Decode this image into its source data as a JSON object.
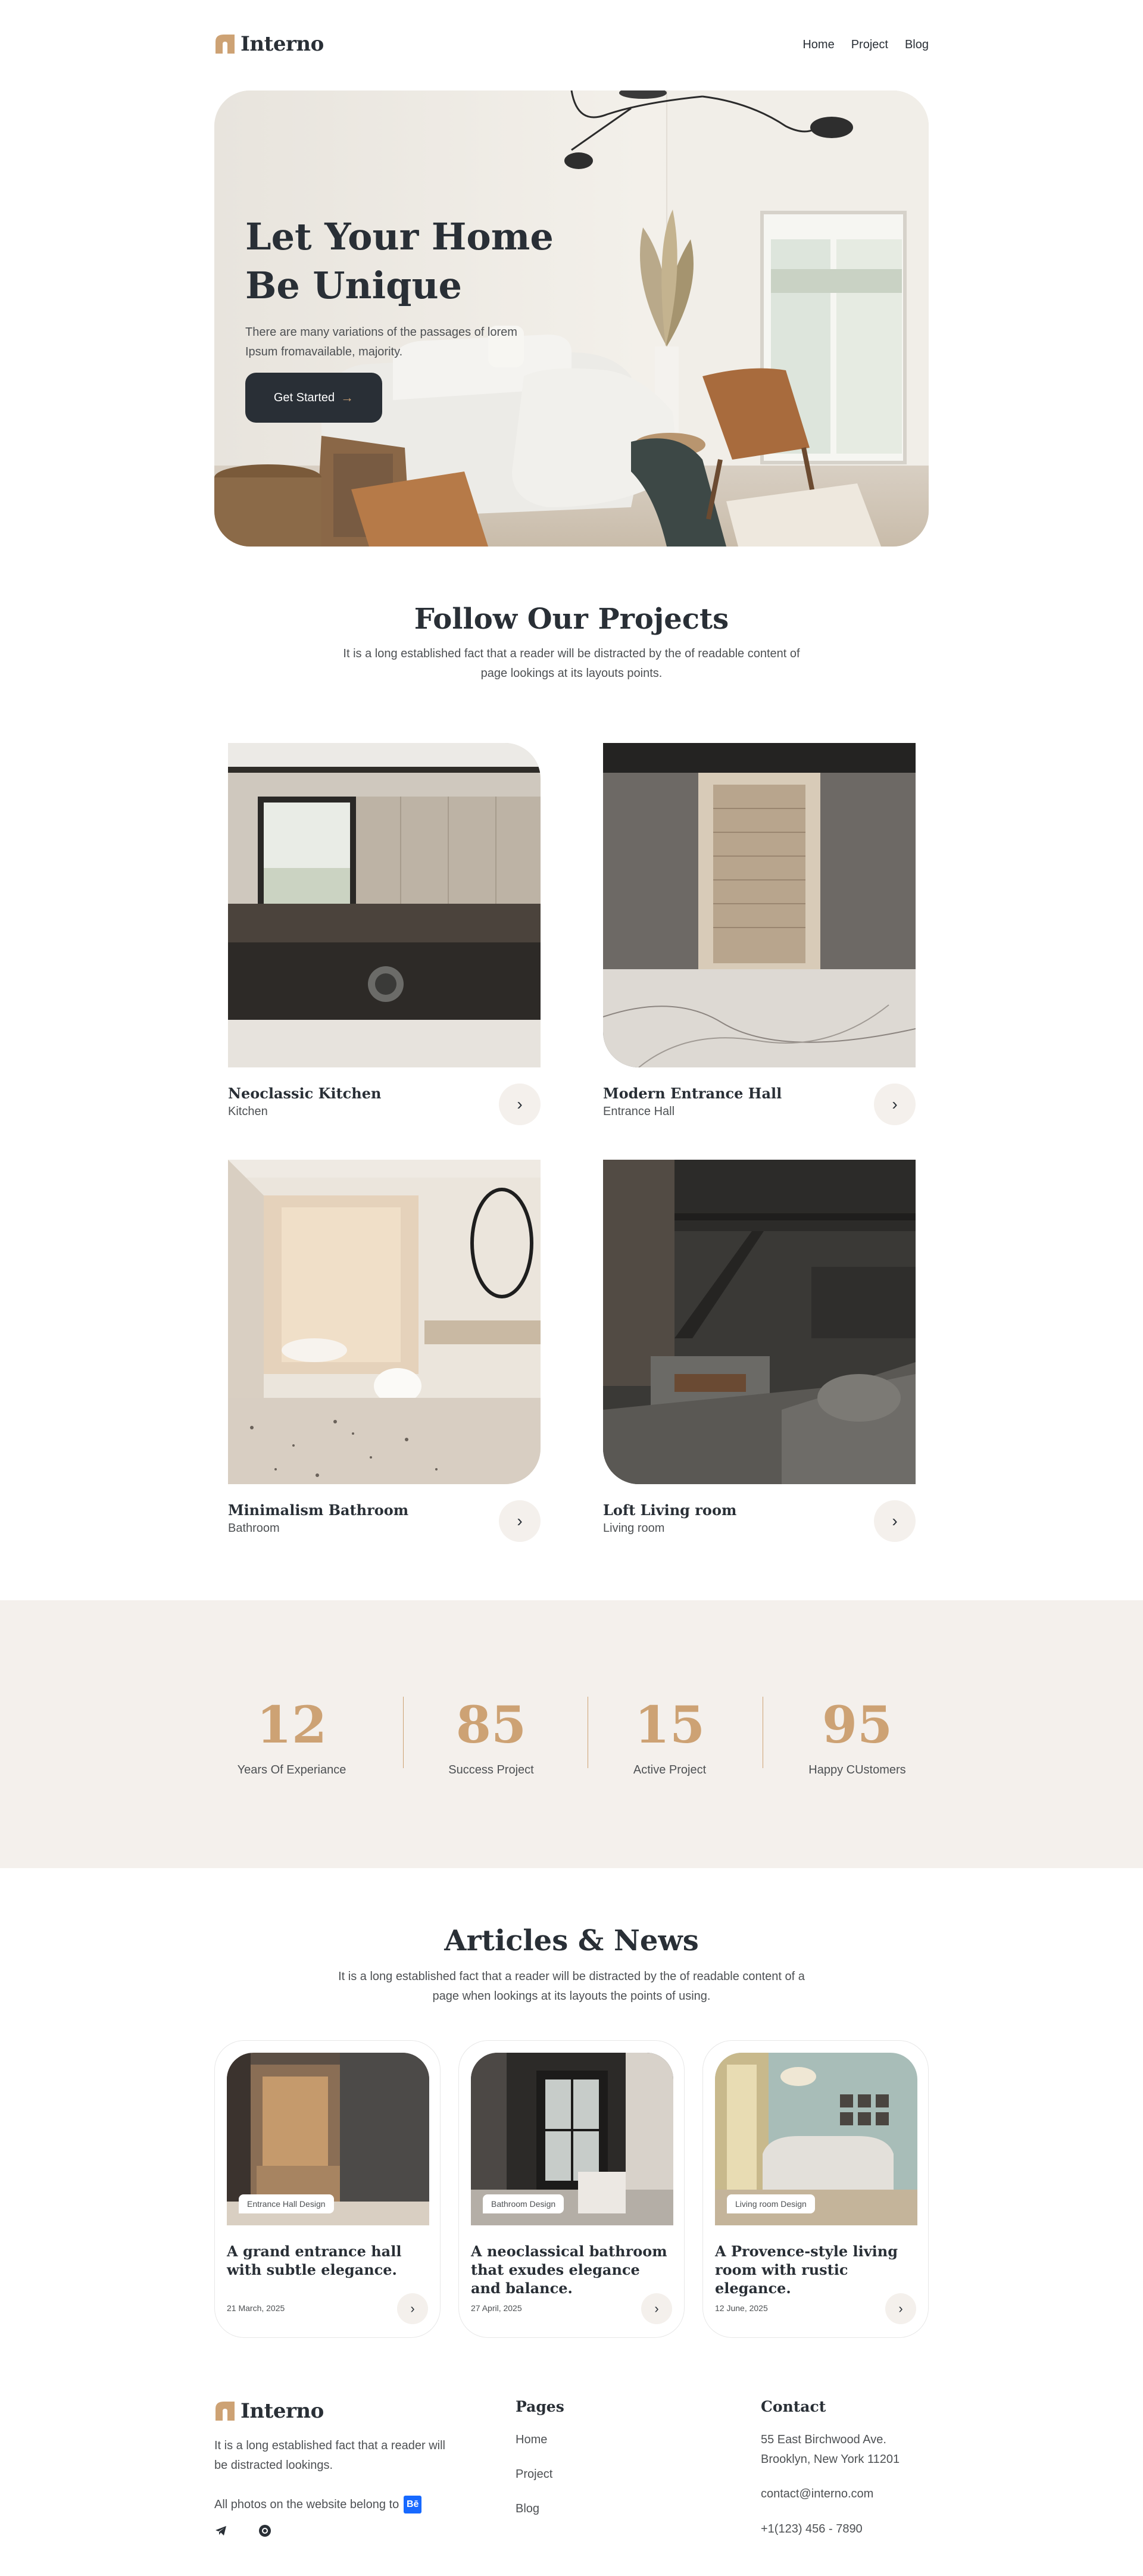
{
  "header": {
    "logo_text": "Interno",
    "nav": [
      "Home",
      "Project",
      "Blog"
    ]
  },
  "hero": {
    "title_line1": "Let Your Home",
    "title_line2": "Be Unique",
    "subtitle": "There are many variations of the passages of lorem Ipsum fromavailable, majority.",
    "cta_label": "Get Started",
    "cta_arrow": "→"
  },
  "projects_section": {
    "title": "Follow Our Projects",
    "subtitle": "It is a long established fact that a reader will be distracted by the of readable content of page lookings at its layouts points.",
    "items": [
      {
        "name": "Neoclassic Kitchen",
        "category": "Kitchen"
      },
      {
        "name": "Modern Entrance Hall",
        "category": "Entrance Hall"
      },
      {
        "name": "Minimalism Bathroom",
        "category": "Bathroom"
      },
      {
        "name": "Loft Living room",
        "category": "Living room"
      }
    ],
    "arrow": "›"
  },
  "stats": [
    {
      "value": "12",
      "label": "Years Of Experiance"
    },
    {
      "value": "85",
      "label": "Success Project"
    },
    {
      "value": "15",
      "label": "Active Project"
    },
    {
      "value": "95",
      "label": "Happy CUstomers"
    }
  ],
  "news_section": {
    "title": "Articles & News",
    "subtitle": "It is a long established fact that a reader will be distracted by the of readable content of a page when lookings at its layouts the points of using.",
    "items": [
      {
        "tag": "Entrance Hall Design",
        "title": "A grand entrance hall with subtle elegance.",
        "date": "21 March, 2025"
      },
      {
        "tag": "Bathroom Design",
        "title": "A neoclassical bathroom that exudes elegance and balance.",
        "date": "27 April, 2025"
      },
      {
        "tag": "Living room Design",
        "title": "A Provence-style living room with rustic elegance.",
        "date": "12 June, 2025"
      }
    ],
    "arrow": "›"
  },
  "footer": {
    "logo_text": "Interno",
    "description": "It is a long established fact that a reader will be distracted lookings.",
    "credit": "All photos on the website belong to",
    "credit_badge": "Bē",
    "socials": [
      "telegram-icon",
      "threads-icon"
    ],
    "pages_title": "Pages",
    "pages": [
      "Home",
      "Project",
      "Blog"
    ],
    "contact_title": "Contact",
    "address_line1": "55 East Birchwood Ave.",
    "address_line2": "Brooklyn, New York 11201",
    "email": "contact@interno.com",
    "phone": "+1(123) 456 - 7890"
  },
  "colors": {
    "accent": "#cda274",
    "dark": "#292f36",
    "beige": "#f4f0ec",
    "text": "#4d5053"
  }
}
